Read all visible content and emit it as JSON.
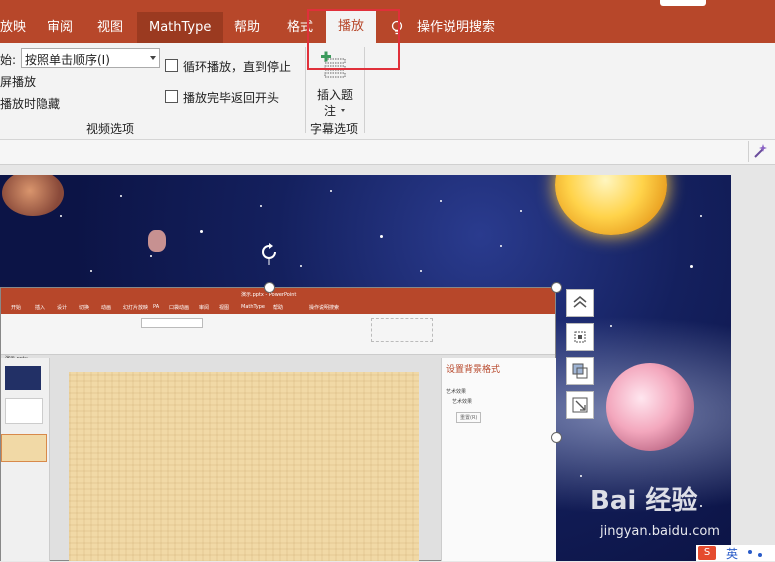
{
  "ribbon_tabs": [
    {
      "label": "放映"
    },
    {
      "label": "审阅"
    },
    {
      "label": "视图"
    },
    {
      "label": "MathType"
    },
    {
      "label": "帮助"
    },
    {
      "label": "格式"
    },
    {
      "label": "播放"
    },
    {
      "label": "操作说明搜索"
    }
  ],
  "active_tab": "播放",
  "ribbon": {
    "start_label": "始:",
    "start_value": "按照单击顺序(I)",
    "fullscreen_label": "屏播放",
    "hide_when_not_playing_label": "播放时隐藏",
    "loop_label": "循环播放，直到停止",
    "rewind_label": "播放完毕返回开头",
    "video_options_group": "视频选项",
    "insert_caption_label_line1": "插入题",
    "insert_caption_label_line2": "注",
    "caption_options_group": "字幕选项"
  },
  "inner_screenshot": {
    "title": "演示.pptx - PowerPoint",
    "tabs": [
      "开始",
      "插入",
      "设计",
      "切换",
      "动画",
      "幻灯片放映",
      "PA",
      "口袋动画",
      "审阅",
      "视图",
      "MathType",
      "帮助",
      "操作说明搜索"
    ],
    "pane_title": "设置背景格式",
    "pane_section": "艺术效果",
    "pane_item": "艺术效果",
    "pane_reset": "重置(R)",
    "file_tab": "演示.pptx"
  },
  "watermark": {
    "brand": "Bai  经验",
    "url": "jingyan.baidu.com"
  },
  "ime": {
    "label": "英"
  },
  "colors": {
    "accent": "#b7472a",
    "highlight": "#e0303a"
  }
}
